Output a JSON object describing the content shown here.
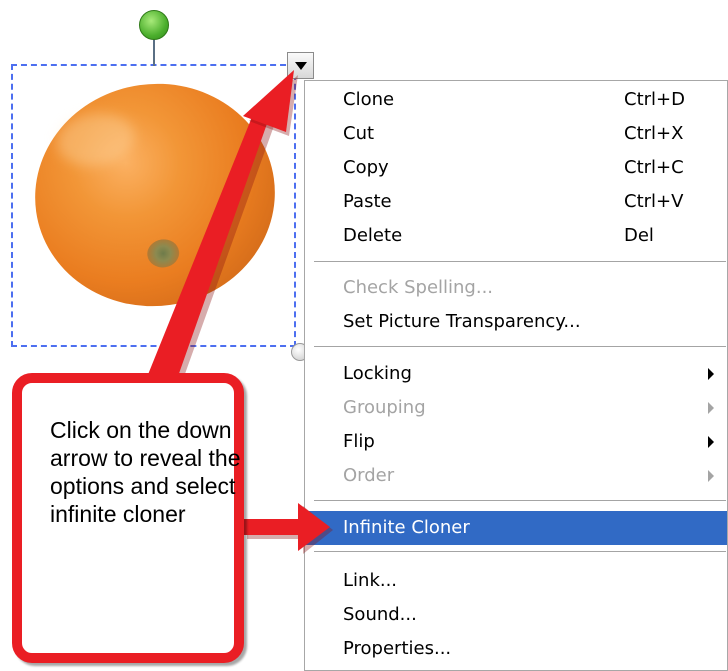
{
  "context_menu": {
    "items": [
      {
        "label": "Clone",
        "shortcut": "Ctrl+D"
      },
      {
        "label": "Cut",
        "shortcut": "Ctrl+X"
      },
      {
        "label": "Copy",
        "shortcut": "Ctrl+C"
      },
      {
        "label": "Paste",
        "shortcut": "Ctrl+V"
      },
      {
        "label": "Delete",
        "shortcut": "Del"
      },
      {
        "label": "Check Spelling...",
        "disabled": true
      },
      {
        "label": "Set Picture Transparency..."
      },
      {
        "label": "Locking",
        "submenu": true
      },
      {
        "label": "Grouping",
        "submenu": true,
        "disabled": true
      },
      {
        "label": "Flip",
        "submenu": true
      },
      {
        "label": "Order",
        "submenu": true,
        "disabled": true
      },
      {
        "label": "Infinite Cloner",
        "highlighted": true
      },
      {
        "label": "Link..."
      },
      {
        "label": "Sound..."
      },
      {
        "label": "Properties..."
      }
    ]
  },
  "callout": {
    "text": "Click on the down arrow to reveal the options and select infinite cloner"
  },
  "colors": {
    "highlight": "#316ac5",
    "callout_border": "#ea1e24",
    "selection_border": "#4d6ff0",
    "disabled_text": "#a4a4a4"
  },
  "icons": [
    "rotate-handle-icon",
    "dropdown-arrow-icon",
    "resize-handle-icon",
    "submenu-arrow-icon"
  ]
}
